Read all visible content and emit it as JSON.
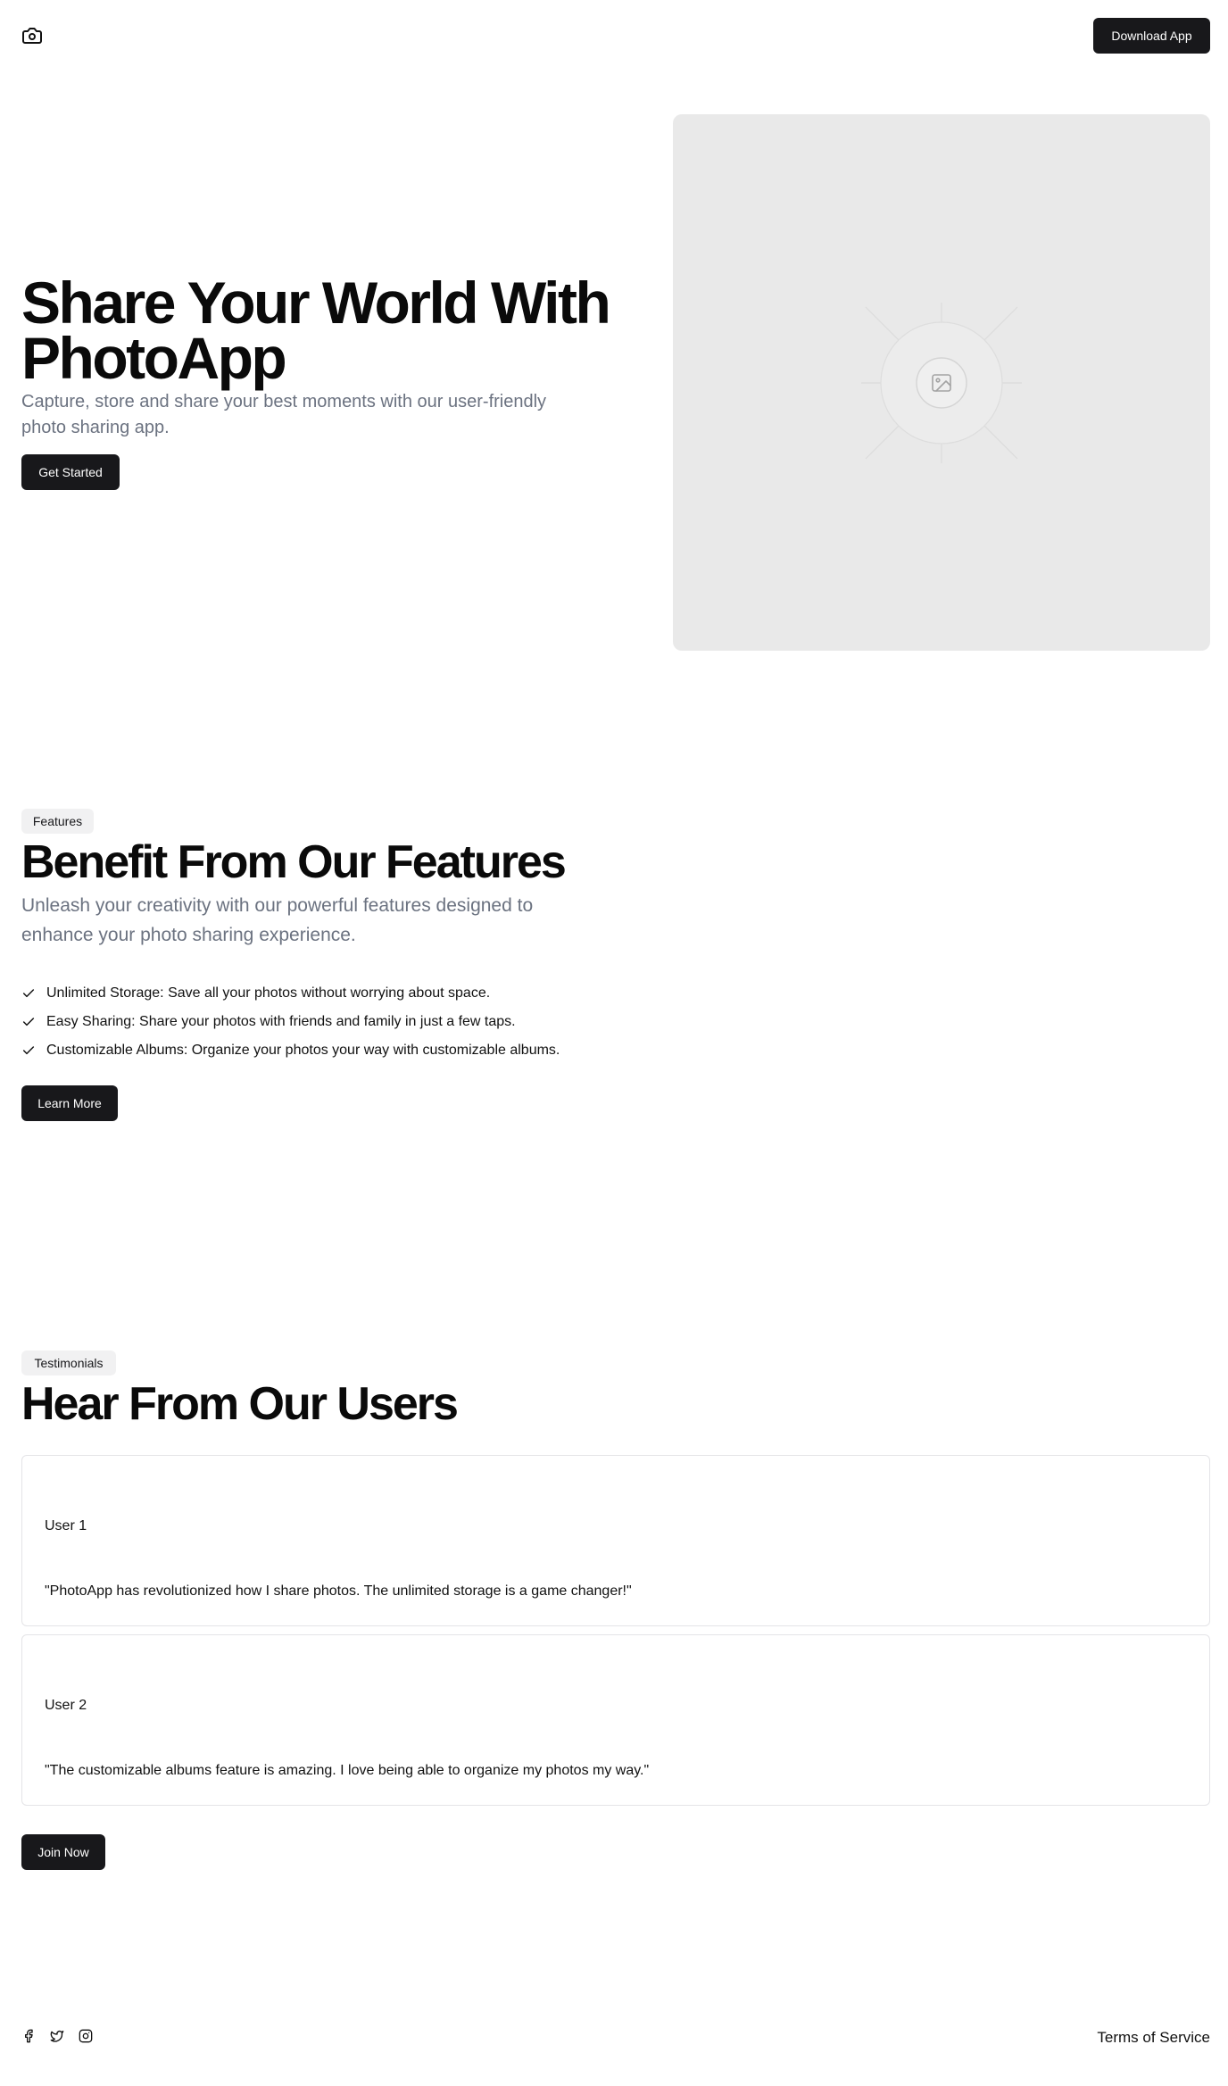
{
  "header": {
    "logo_icon": "camera-icon",
    "download_label": "Download App"
  },
  "hero": {
    "title": "Share Your World With PhotoApp",
    "subtitle": "Capture, store and share your best moments with our user-friendly photo sharing app.",
    "cta_label": "Get Started",
    "image_icon": "image-placeholder-icon"
  },
  "features": {
    "badge": "Features",
    "title": "Benefit From Our Features",
    "subtitle": "Unleash your creativity with our powerful features designed to enhance your photo sharing experience.",
    "items": [
      {
        "text": "Unlimited Storage: Save all your photos without worrying about space.",
        "icon": "check-icon"
      },
      {
        "text": "Easy Sharing: Share your photos with friends and family in just a few taps.",
        "icon": "check-icon"
      },
      {
        "text": "Customizable Albums: Organize your photos your way with customizable albums.",
        "icon": "check-icon"
      }
    ],
    "cta_label": "Learn More"
  },
  "testimonials": {
    "badge": "Testimonials",
    "title": "Hear From Our Users",
    "items": [
      {
        "name": "User 1",
        "quote": "\"PhotoApp has revolutionized how I share photos. The unlimited storage is a game changer!\""
      },
      {
        "name": "User 2",
        "quote": "\"The customizable albums feature is amazing. I love being able to organize my photos my way.\""
      }
    ],
    "cta_label": "Join Now"
  },
  "footer": {
    "social_icons": [
      "facebook-icon",
      "twitter-icon",
      "instagram-icon"
    ],
    "terms_label": "Terms of Service"
  },
  "colors": {
    "primary_button": "#18181b",
    "muted_text": "#6b7280",
    "image_placeholder_bg": "#e9e9e9"
  }
}
